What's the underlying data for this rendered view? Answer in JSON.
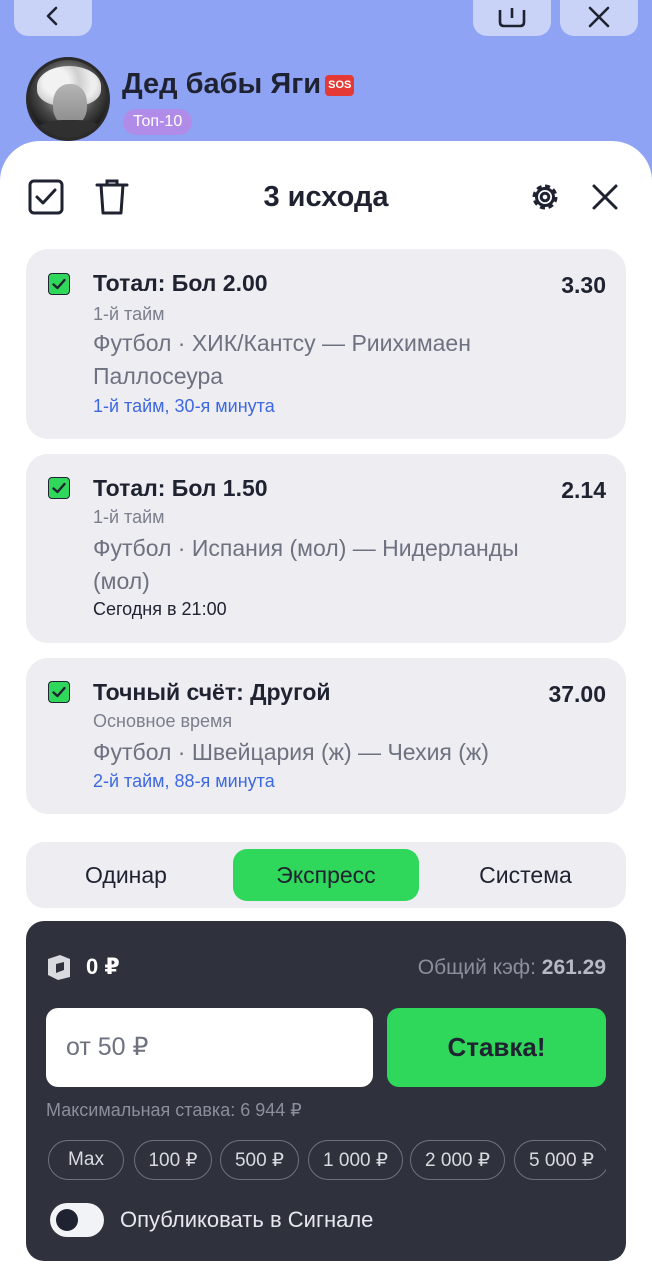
{
  "profile": {
    "name": "Дед бабы Яги",
    "badge": "SOS",
    "rank": "Топ-10"
  },
  "slip": {
    "title": "3 исхода",
    "bets": [
      {
        "title": "Тотал: Бол 2.00",
        "odds": "3.30",
        "period": "1-й тайм",
        "match": "Футбол · ХИК/Кантсу — Риихимаен Паллосеура",
        "time": "1-й тайм, 30-я минута",
        "live": true
      },
      {
        "title": "Тотал: Бол 1.50",
        "odds": "2.14",
        "period": "1-й тайм",
        "match": "Футбол · Испания (мол) — Нидерланды (мол)",
        "time": "Сегодня в 21:00",
        "live": false
      },
      {
        "title": "Точный счёт: Другой",
        "odds": "37.00",
        "period": "Основное время",
        "match": "Футбол · Швейцария (ж) — Чехия (ж)",
        "time": "2-й тайм, 88-я минута",
        "live": true
      }
    ],
    "tabs": [
      "Одинар",
      "Экспресс",
      "Система"
    ],
    "active_tab": "Экспресс"
  },
  "panel": {
    "balance": "0 ₽",
    "coef_label": "Общий кэф:",
    "coef_value": "261.29",
    "amount_placeholder": "от 50 ₽",
    "bet_button": "Ставка!",
    "max_bet": "Максимальная ставка: 6 944 ₽",
    "chips": [
      "Max",
      "100 ₽",
      "500 ₽",
      "1 000 ₽",
      "2 000 ₽",
      "5 000 ₽"
    ],
    "publish_label": "Опубликовать в Сигнале",
    "publish_on": false
  },
  "colors": {
    "accent_green": "#2fd75a",
    "live_blue": "#3d68e0",
    "panel_dark": "#2f323d",
    "header_blue": "#8fa3f5"
  }
}
